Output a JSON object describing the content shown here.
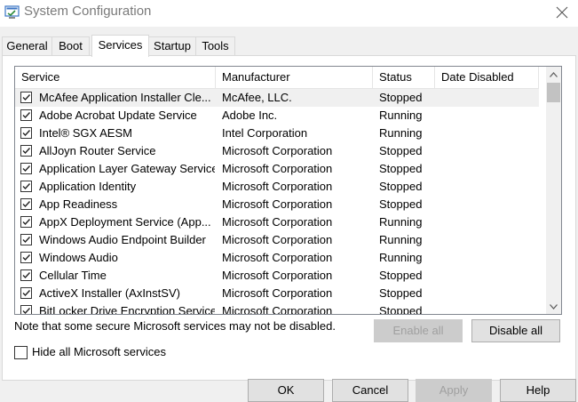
{
  "window": {
    "title": "System Configuration"
  },
  "tabs": [
    {
      "label": "General"
    },
    {
      "label": "Boot"
    },
    {
      "label": "Services",
      "active": true
    },
    {
      "label": "Startup"
    },
    {
      "label": "Tools"
    }
  ],
  "table": {
    "columns": [
      "Service",
      "Manufacturer",
      "Status",
      "Date Disabled"
    ],
    "rows": [
      {
        "service": "McAfee Application Installer Cle...",
        "manufacturer": "McAfee, LLC.",
        "status": "Stopped",
        "date_disabled": "",
        "checked": true
      },
      {
        "service": "Adobe Acrobat Update Service",
        "manufacturer": "Adobe Inc.",
        "status": "Running",
        "date_disabled": "",
        "checked": true
      },
      {
        "service": "Intel® SGX AESM",
        "manufacturer": "Intel Corporation",
        "status": "Running",
        "date_disabled": "",
        "checked": true
      },
      {
        "service": "AllJoyn Router Service",
        "manufacturer": "Microsoft Corporation",
        "status": "Stopped",
        "date_disabled": "",
        "checked": true
      },
      {
        "service": "Application Layer Gateway Service",
        "manufacturer": "Microsoft Corporation",
        "status": "Stopped",
        "date_disabled": "",
        "checked": true
      },
      {
        "service": "Application Identity",
        "manufacturer": "Microsoft Corporation",
        "status": "Stopped",
        "date_disabled": "",
        "checked": true
      },
      {
        "service": "App Readiness",
        "manufacturer": "Microsoft Corporation",
        "status": "Stopped",
        "date_disabled": "",
        "checked": true
      },
      {
        "service": "AppX Deployment Service (App...",
        "manufacturer": "Microsoft Corporation",
        "status": "Running",
        "date_disabled": "",
        "checked": true
      },
      {
        "service": "Windows Audio Endpoint Builder",
        "manufacturer": "Microsoft Corporation",
        "status": "Running",
        "date_disabled": "",
        "checked": true
      },
      {
        "service": "Windows Audio",
        "manufacturer": "Microsoft Corporation",
        "status": "Running",
        "date_disabled": "",
        "checked": true
      },
      {
        "service": "Cellular Time",
        "manufacturer": "Microsoft Corporation",
        "status": "Stopped",
        "date_disabled": "",
        "checked": true
      },
      {
        "service": "ActiveX Installer (AxInstSV)",
        "manufacturer": "Microsoft Corporation",
        "status": "Stopped",
        "date_disabled": "",
        "checked": true
      },
      {
        "service": "BitLocker Drive Encryption Service",
        "manufacturer": "Microsoft Corporation",
        "status": "Stopped",
        "date_disabled": "",
        "checked": true
      }
    ]
  },
  "note": "Note that some secure Microsoft services may not be disabled.",
  "buttons": {
    "enable_all": "Enable all",
    "disable_all": "Disable all",
    "ok": "OK",
    "cancel": "Cancel",
    "apply": "Apply",
    "help": "Help"
  },
  "hide_ms": {
    "label": "Hide all Microsoft services",
    "checked": false
  },
  "colors": {
    "title_text": "#7a7a7a",
    "selected_row": "#f0f0f0",
    "disabled_text": "#a0a0a0"
  }
}
